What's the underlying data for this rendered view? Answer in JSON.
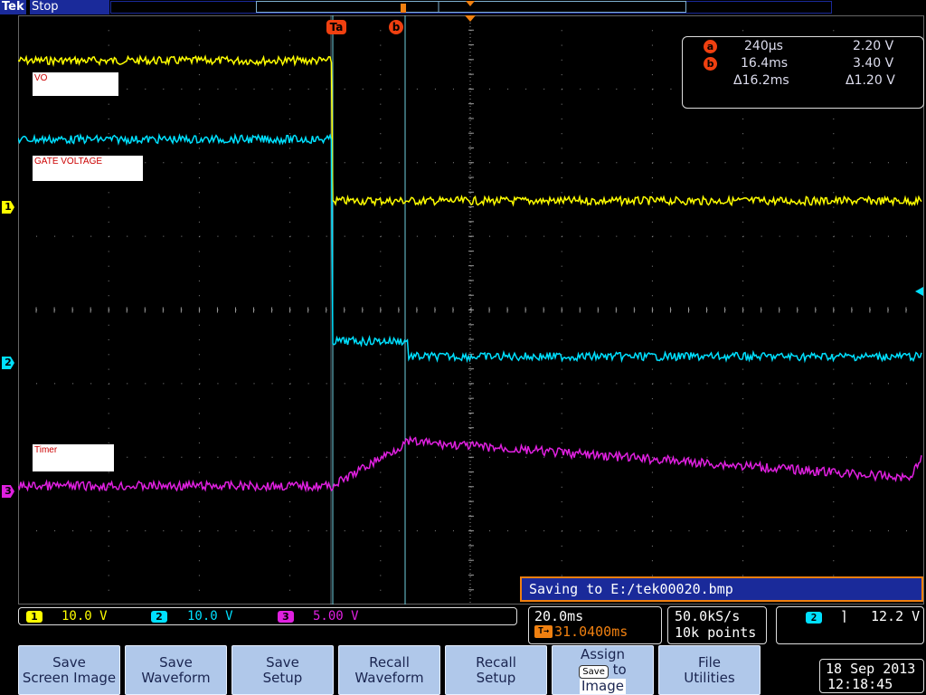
{
  "header": {
    "brand": "Tek",
    "status": "Stop"
  },
  "cursors": {
    "a_label": "a",
    "b_label": "b",
    "a_time": "240µs",
    "a_volt": "2.20 V",
    "b_time": "16.4ms",
    "b_volt": "3.40 V",
    "delta_time": "Δ16.2ms",
    "delta_volt": "Δ1.20 V"
  },
  "trace_labels": {
    "vo": "VO",
    "gate": "GATE VOLTAGE",
    "timer": "Timer"
  },
  "channel_markers": [
    "1",
    "2",
    "3"
  ],
  "message": "Saving to E:/tek00020.bmp",
  "channels": [
    {
      "num": "1",
      "scale": "10.0 V",
      "color": "#ffff00"
    },
    {
      "num": "2",
      "scale": "10.0 V",
      "color": "#00e0ff"
    },
    {
      "num": "3",
      "scale": "5.00 V",
      "color": "#e020e0"
    }
  ],
  "timebase": {
    "scale": "20.0ms",
    "trigger_pos": "31.0400ms"
  },
  "acquisition": {
    "rate": "50.0kS/s",
    "points": "10k points"
  },
  "trigger": {
    "channel": "2",
    "slope": "falling",
    "level": "12.2 V"
  },
  "softkeys": [
    {
      "line1": "Save",
      "line2": "Screen Image"
    },
    {
      "line1": "Save",
      "line2": "Waveform"
    },
    {
      "line1": "Save",
      "line2": "Setup"
    },
    {
      "line1": "Recall",
      "line2": "Waveform"
    },
    {
      "line1": "Recall",
      "line2": "Setup"
    },
    {
      "line1": "Assign",
      "mid_badge": "Save",
      "mid_text": "to",
      "line2": "Image"
    },
    {
      "line1": "File",
      "line2": "Utilities"
    }
  ],
  "datetime": {
    "date": "18 Sep  2013",
    "time": "12:18:45"
  },
  "colors": {
    "ch1": "#ffff00",
    "ch2": "#00e0ff",
    "ch3": "#e020e0",
    "cursor": "#f04010",
    "accent": "#f08010",
    "menu_bg": "#1a2a9a",
    "softkey_bg": "#b0c8ea"
  }
}
